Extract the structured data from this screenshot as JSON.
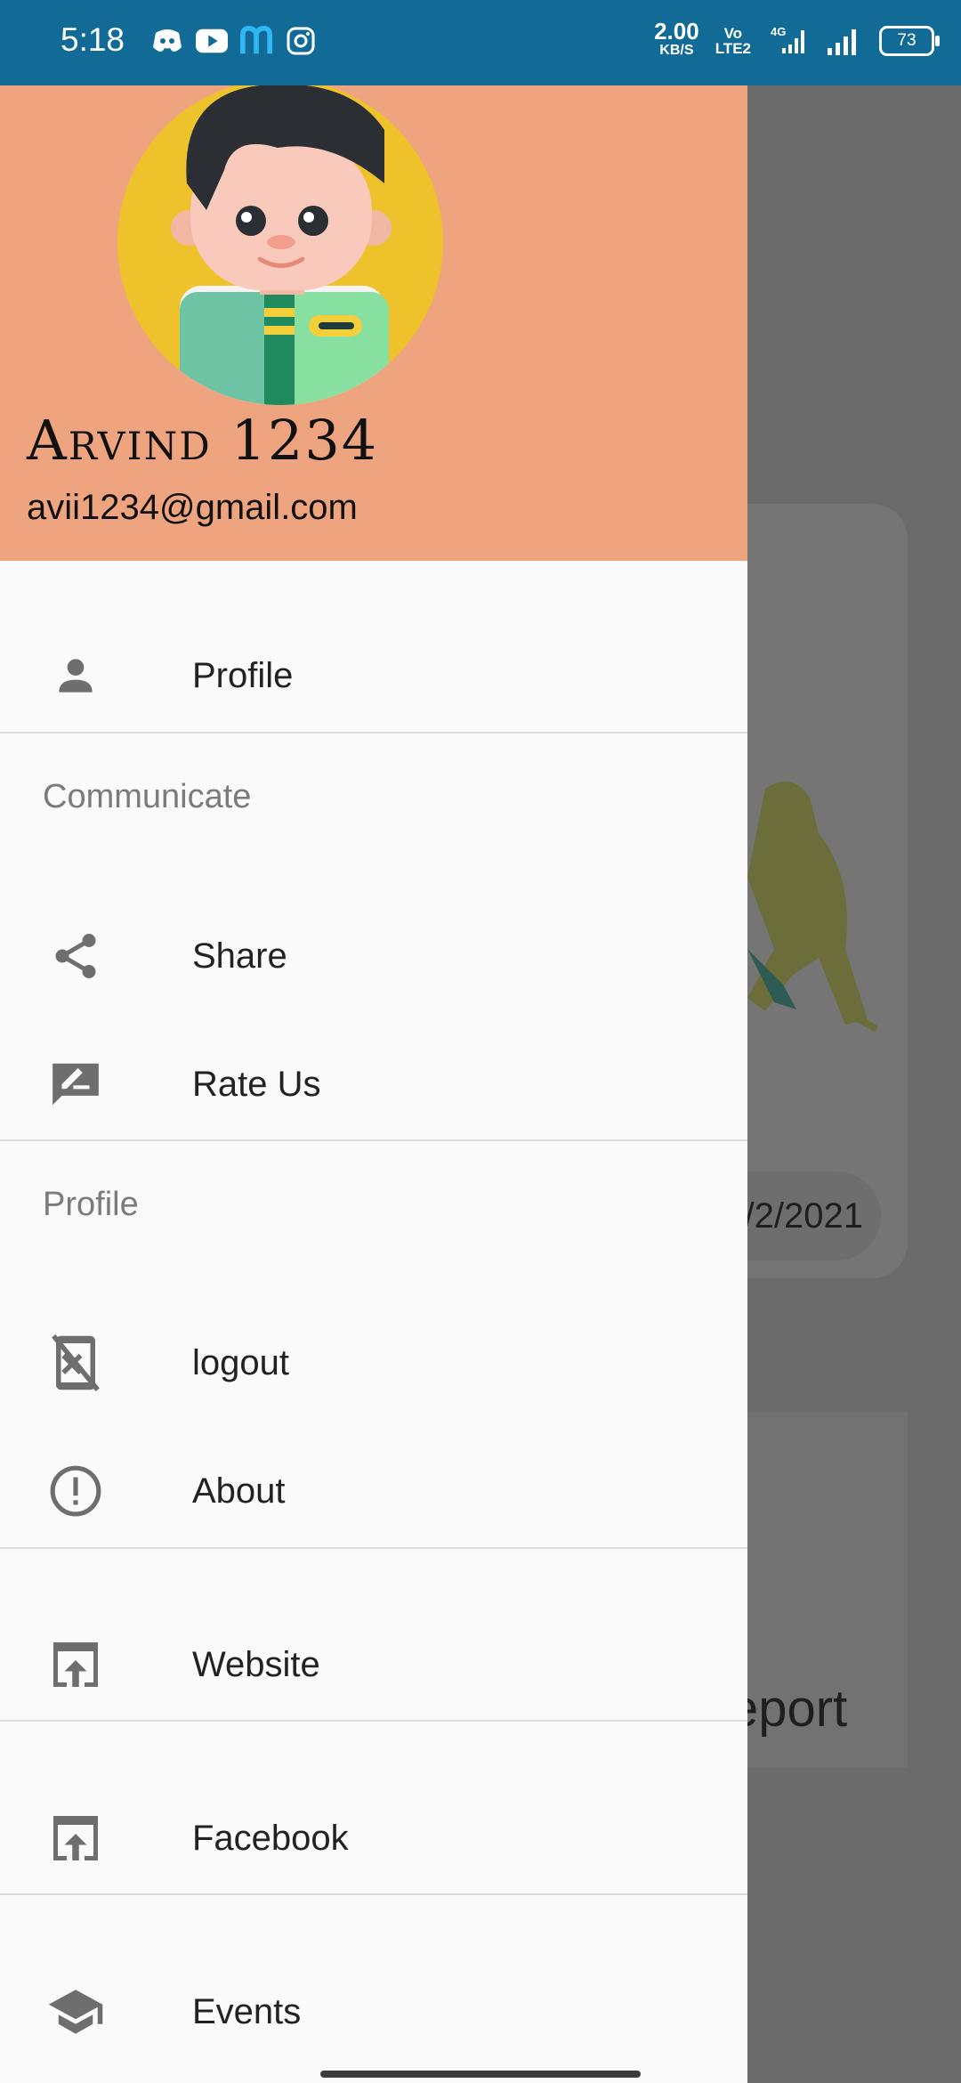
{
  "status_bar": {
    "time": "5:18",
    "net_speed": "2.00",
    "net_unit": "KB/S",
    "volte_top": "Vo",
    "volte_bottom": "LTE2",
    "network_type": "4G",
    "battery": "73"
  },
  "drawer": {
    "header": {
      "name": "Arvind 1234",
      "email": "avii1234@gmail.com",
      "bg_color": "#efa480"
    },
    "items": [
      {
        "label": "Profile",
        "icon": "person-icon"
      },
      {
        "section": "Communicate"
      },
      {
        "label": "Share",
        "icon": "share-icon"
      },
      {
        "label": "Rate Us",
        "icon": "rate-review-icon"
      },
      {
        "section": "Profile"
      },
      {
        "label": "logout",
        "icon": "phonelink-erase-icon"
      },
      {
        "label": "About",
        "icon": "error-outline-icon"
      },
      {
        "label": "Website",
        "icon": "open-in-browser-icon"
      },
      {
        "label": "Facebook",
        "icon": "open-in-browser-icon"
      },
      {
        "label": "Events",
        "icon": "school-icon"
      }
    ]
  },
  "background": {
    "date_partial": "/2/2021",
    "report_partial": "eport"
  },
  "colors": {
    "status_bar": "#126a96",
    "scrim": "#6b6b6b",
    "icon": "#6e6e6e"
  }
}
